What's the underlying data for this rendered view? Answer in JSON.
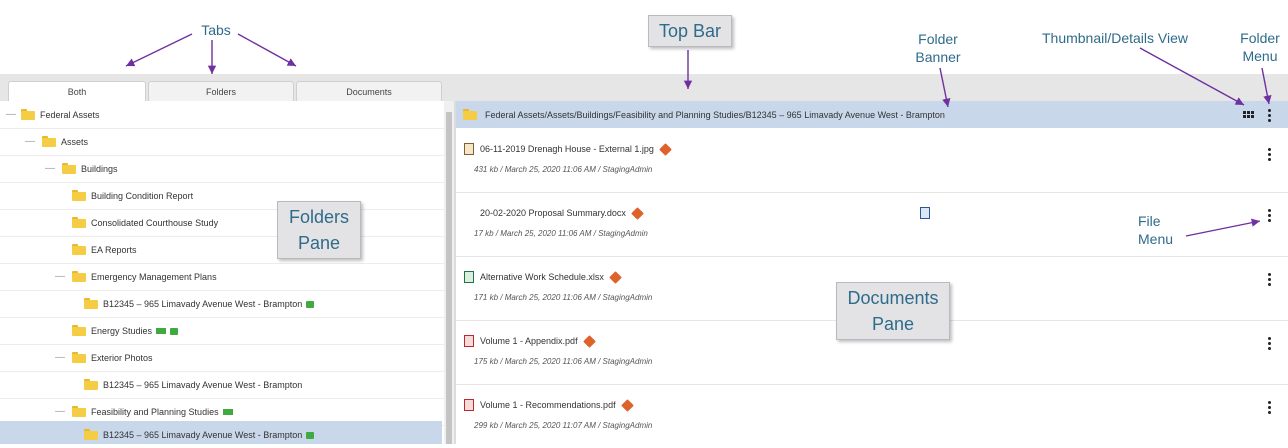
{
  "annotations": {
    "tabs": "Tabs",
    "top_bar": "Top Bar",
    "folder_banner_line1": "Folder",
    "folder_banner_line2": "Banner",
    "thumbnail_view": "Thumbnail/Details View",
    "folder_menu_line1": "Folder",
    "folder_menu_line2": "Menu",
    "folders_pane_line1": "Folders",
    "folders_pane_line2": "Pane",
    "file_menu_line1": "File",
    "file_menu_line2": "Menu",
    "documents_pane_line1": "Documents",
    "documents_pane_line2": "Pane"
  },
  "tabs": [
    "Both",
    "Folders",
    "Documents"
  ],
  "tree": [
    {
      "label": "Federal Assets"
    },
    {
      "label": "Assets"
    },
    {
      "label": "Buildings"
    },
    {
      "label": "Building Condition Report"
    },
    {
      "label": "Consolidated Courthouse Study"
    },
    {
      "label": "EA Reports"
    },
    {
      "label": "Emergency Management Plans"
    },
    {
      "label": "B12345 – 965 Limavady Avenue West - Brampton"
    },
    {
      "label": "Energy Studies"
    },
    {
      "label": "Exterior Photos"
    },
    {
      "label": "B12345 – 965 Limavady Avenue West - Brampton"
    },
    {
      "label": "Feasibility and Planning Studies"
    },
    {
      "label": "B12345 – 965 Limavady Avenue West - Brampton"
    }
  ],
  "banner": {
    "path": "Federal Assets/Assets/Buildings/Feasibility and Planning Studies/B12345 – 965 Limavady Avenue West - Brampton",
    "view_icon": "grid-icon",
    "menu_icon": "kebab-icon"
  },
  "documents": [
    {
      "name": "06-11-2019 Drenagh House - External 1.jpg",
      "meta": "431 kb / March 25, 2020 11:06 AM / StagingAdmin",
      "icon": "image-file-icon"
    },
    {
      "name": "20-02-2020 Proposal Summary.docx",
      "meta": "17 kb / March 25, 2020 11:06 AM / StagingAdmin",
      "icon": "word-file-icon"
    },
    {
      "name": "Alternative Work Schedule.xlsx",
      "meta": "171 kb / March 25, 2020 11:06 AM / StagingAdmin",
      "icon": "excel-file-icon"
    },
    {
      "name": "Volume 1 - Appendix.pdf",
      "meta": "175 kb / March 25, 2020 11:06 AM / StagingAdmin",
      "icon": "pdf-file-icon"
    },
    {
      "name": "Volume 1 - Recommendations.pdf",
      "meta": "299 kb / March 25, 2020 11:07 AM / StagingAdmin",
      "icon": "pdf-file-icon"
    }
  ],
  "colors": {
    "selected_row": "#c8d7ea",
    "banner": "#c8d7ea",
    "folder": "#f5cd45",
    "warning": "#e0622b",
    "annotation_text": "#2f6b8a",
    "arrow": "#7030a0"
  }
}
